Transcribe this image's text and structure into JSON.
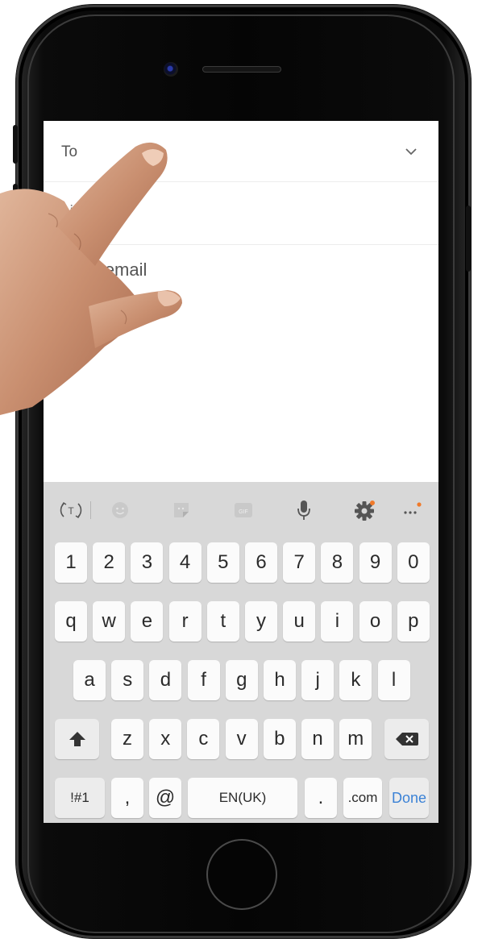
{
  "compose": {
    "to_label": "To",
    "subject_partial": "bj",
    "body_placeholder": "pose email"
  },
  "keyboard": {
    "toolbar_icons": [
      "text-mode-icon",
      "emoji-icon",
      "sticker-icon",
      "gif-icon",
      "mic-icon",
      "settings-icon",
      "more-icon"
    ],
    "gif_label": "GIF",
    "row_numbers": [
      "1",
      "2",
      "3",
      "4",
      "5",
      "6",
      "7",
      "8",
      "9",
      "0"
    ],
    "row_1": [
      "q",
      "w",
      "e",
      "r",
      "t",
      "y",
      "u",
      "i",
      "o",
      "p"
    ],
    "row_2": [
      "a",
      "s",
      "d",
      "f",
      "g",
      "h",
      "j",
      "k",
      "l"
    ],
    "row_3": [
      "z",
      "x",
      "c",
      "v",
      "b",
      "n",
      "m"
    ],
    "symbols_label": "!#1",
    "comma_label": ",",
    "at_label": "@",
    "space_label": "EN(UK)",
    "period_label": ".",
    "dotcom_label": ".com",
    "done_label": "Done"
  },
  "colors": {
    "accent": "#3b82d6",
    "notification_dot": "#f07a2b",
    "keyboard_bg": "#d8d8d8"
  }
}
